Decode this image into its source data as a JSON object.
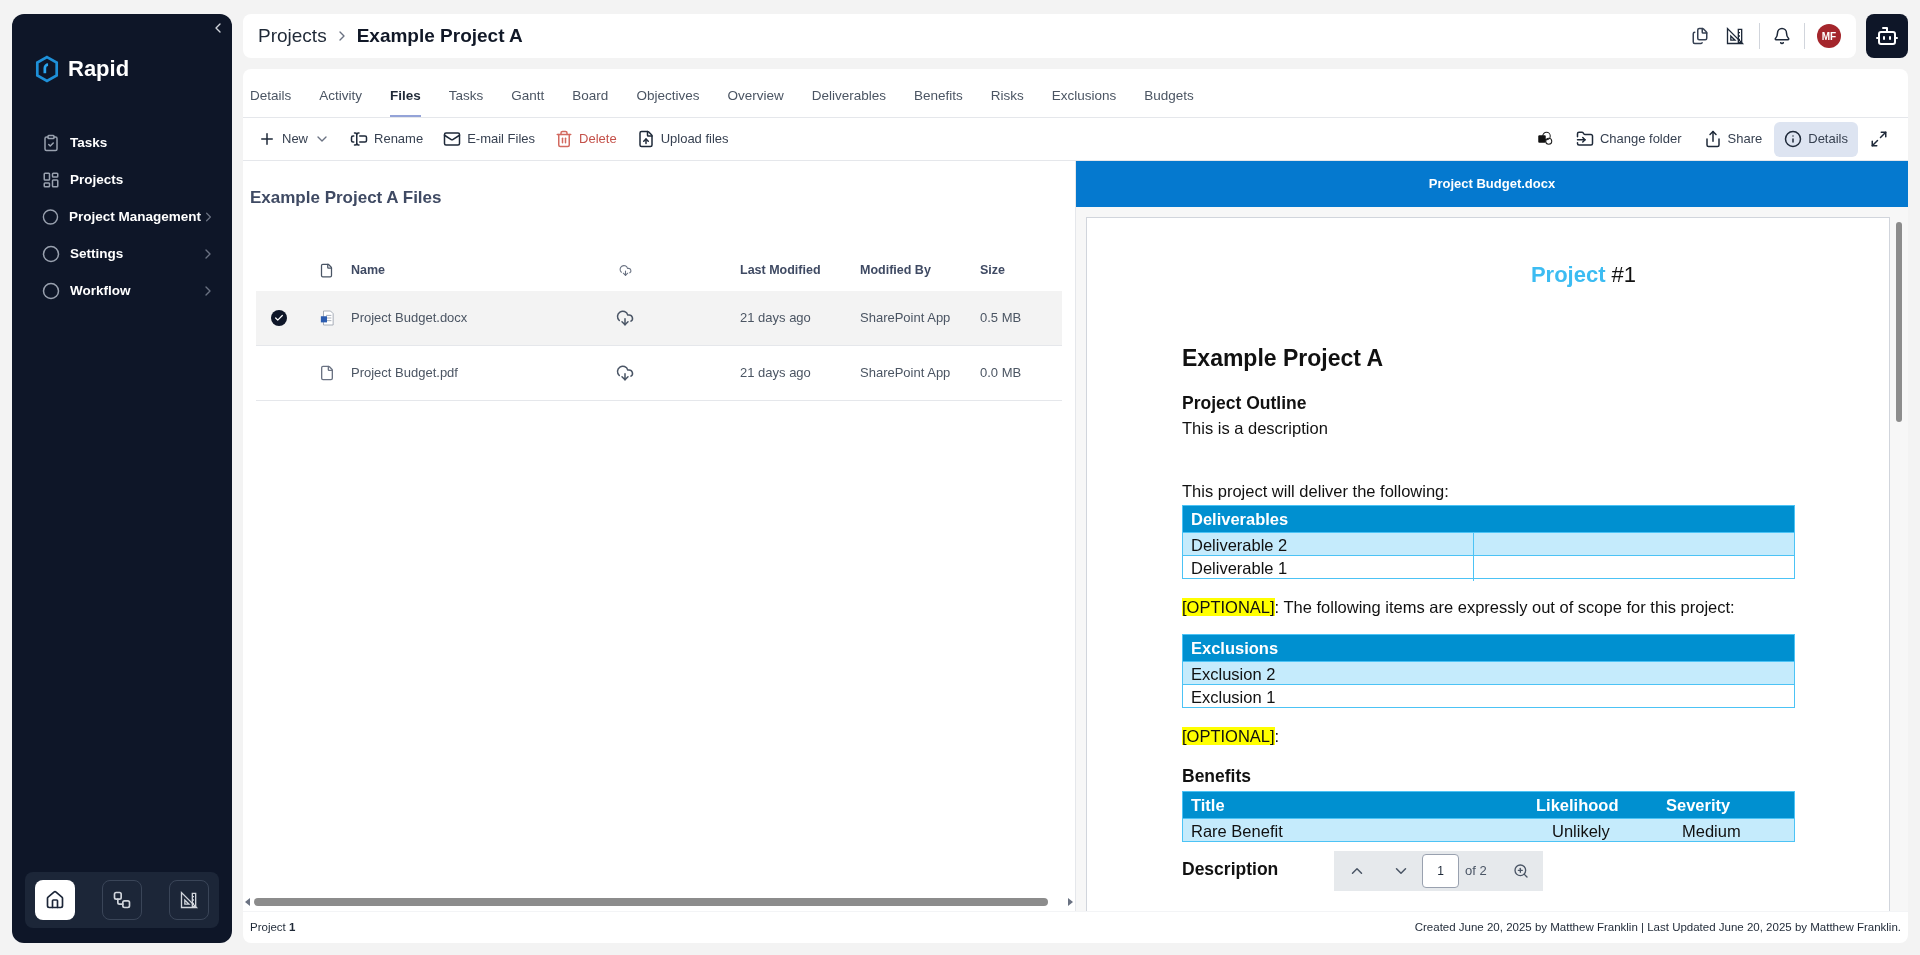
{
  "sidebar": {
    "logo_text": "Rapid",
    "items": [
      {
        "label": "Tasks",
        "kind": "link"
      },
      {
        "label": "Projects",
        "kind": "link"
      },
      {
        "label": "Project Management",
        "kind": "group"
      },
      {
        "label": "Settings",
        "kind": "group"
      },
      {
        "label": "Workflow",
        "kind": "group"
      }
    ],
    "bottom_buttons": [
      {
        "selected": true
      },
      {
        "selected": false
      },
      {
        "selected": false
      }
    ]
  },
  "header": {
    "breadcrumb": [
      "Projects",
      "Example Project A"
    ],
    "avatar": "MF"
  },
  "tabs": [
    {
      "label": "Details",
      "selected": false
    },
    {
      "label": "Activity",
      "selected": false
    },
    {
      "label": "Files",
      "selected": true
    },
    {
      "label": "Tasks",
      "selected": false
    },
    {
      "label": "Gantt",
      "selected": false
    },
    {
      "label": "Board",
      "selected": false
    },
    {
      "label": "Objectives",
      "selected": false
    },
    {
      "label": "Overview",
      "selected": false
    },
    {
      "label": "Deliverables",
      "selected": false
    },
    {
      "label": "Benefits",
      "selected": false
    },
    {
      "label": "Risks",
      "selected": false
    },
    {
      "label": "Exclusions",
      "selected": false
    },
    {
      "label": "Budgets",
      "selected": false
    }
  ],
  "toolbar": {
    "left": [
      {
        "label": "New",
        "kind": "dropdown"
      },
      {
        "label": "Rename",
        "kind": "plain"
      },
      {
        "label": "E-mail Files",
        "kind": "plain"
      },
      {
        "label": "Delete",
        "kind": "danger"
      },
      {
        "label": "Upload files",
        "kind": "plain"
      }
    ],
    "right": [
      {
        "selected": false
      },
      {
        "label": "Change folder",
        "selected": false
      },
      {
        "label": "Share",
        "selected": false
      },
      {
        "label": "Details",
        "selected": true
      },
      {
        "selected": false
      }
    ]
  },
  "files": {
    "title": "Example Project A Files",
    "columns": [
      "Name",
      "Last Modified",
      "Modified By",
      "Size"
    ],
    "rows": [
      {
        "name": "Project Budget.docx",
        "modified": "21 days ago",
        "modified_by": "SharePoint App",
        "size": "0.5 MB",
        "selected": true
      },
      {
        "name": "Project Budget.pdf",
        "modified": "21 days ago",
        "modified_by": "SharePoint App",
        "size": "0.0 MB",
        "selected": false
      }
    ]
  },
  "preview": {
    "title": "Project Budget.docx",
    "doc_label": "Project",
    "doc_number": "#1",
    "blocks": [
      {
        "kind": "title",
        "text": "Example Project A"
      },
      {
        "kind": "heading",
        "text": "Project Outline"
      },
      {
        "kind": "text",
        "text": "This is a description"
      },
      {
        "kind": "paragraph",
        "text": "This project will deliver the following:"
      },
      {
        "kind": "table",
        "columns": [
          "Deliverables"
        ],
        "rows": [
          [
            "Deliverable 2"
          ],
          [
            "Deliverable 1"
          ]
        ]
      },
      {
        "kind": "note",
        "tag": "[OPTIONAL]",
        "text": ": The following items are expressly out of scope for this project:"
      },
      {
        "kind": "table",
        "columns": [
          "Exclusions"
        ],
        "rows": [
          [
            "Exclusion 2"
          ],
          [
            "Exclusion 1"
          ]
        ]
      },
      {
        "kind": "note",
        "tag": "[OPTIONAL]",
        "text": ":"
      },
      {
        "kind": "heading",
        "text": "Benefits"
      },
      {
        "kind": "table",
        "columns": [
          "Title",
          "Likelihood",
          "Severity"
        ],
        "rows": [
          [
            "Rare Benefit",
            "Unlikely",
            "Medium"
          ]
        ]
      },
      {
        "kind": "heading",
        "text": "Description"
      }
    ],
    "pager": {
      "page": "1",
      "total": "of 2"
    }
  },
  "footer": {
    "left": "Project **1**",
    "right": "Created June 20, 2025 by Matthew Franklin | Last Updated June 20, 2025 by Matthew Franklin."
  }
}
